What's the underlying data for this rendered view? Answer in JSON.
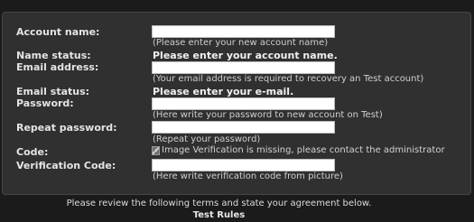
{
  "form": {
    "account_name_label": "Account name:",
    "account_name_value": "",
    "account_name_hint": "(Please enter your new account name)",
    "name_status_label": "Name status:",
    "name_status_value": "Please enter your account name.",
    "email_label": "Email address:",
    "email_value": "",
    "email_hint": "(Your email address is required to recovery an Test account)",
    "email_status_label": "Email status:",
    "email_status_value": "Please enter your e-mail.",
    "password_label": "Password:",
    "password_value": "",
    "password_hint": "(Here write your password to new account on Test)",
    "repeat_password_label": "Repeat password:",
    "repeat_password_value": "",
    "repeat_password_hint": "(Repeat your password)",
    "code_label": "Code:",
    "code_image_alt": "Image Verification is missing, please contact the administrator",
    "verification_code_label": "Verification Code:",
    "verification_code_value": "",
    "verification_code_hint": "(Here write verification code from picture)"
  },
  "footer": {
    "terms_text": "Please review the following terms and state your agreement below.",
    "rules_link": "Test Rules"
  }
}
